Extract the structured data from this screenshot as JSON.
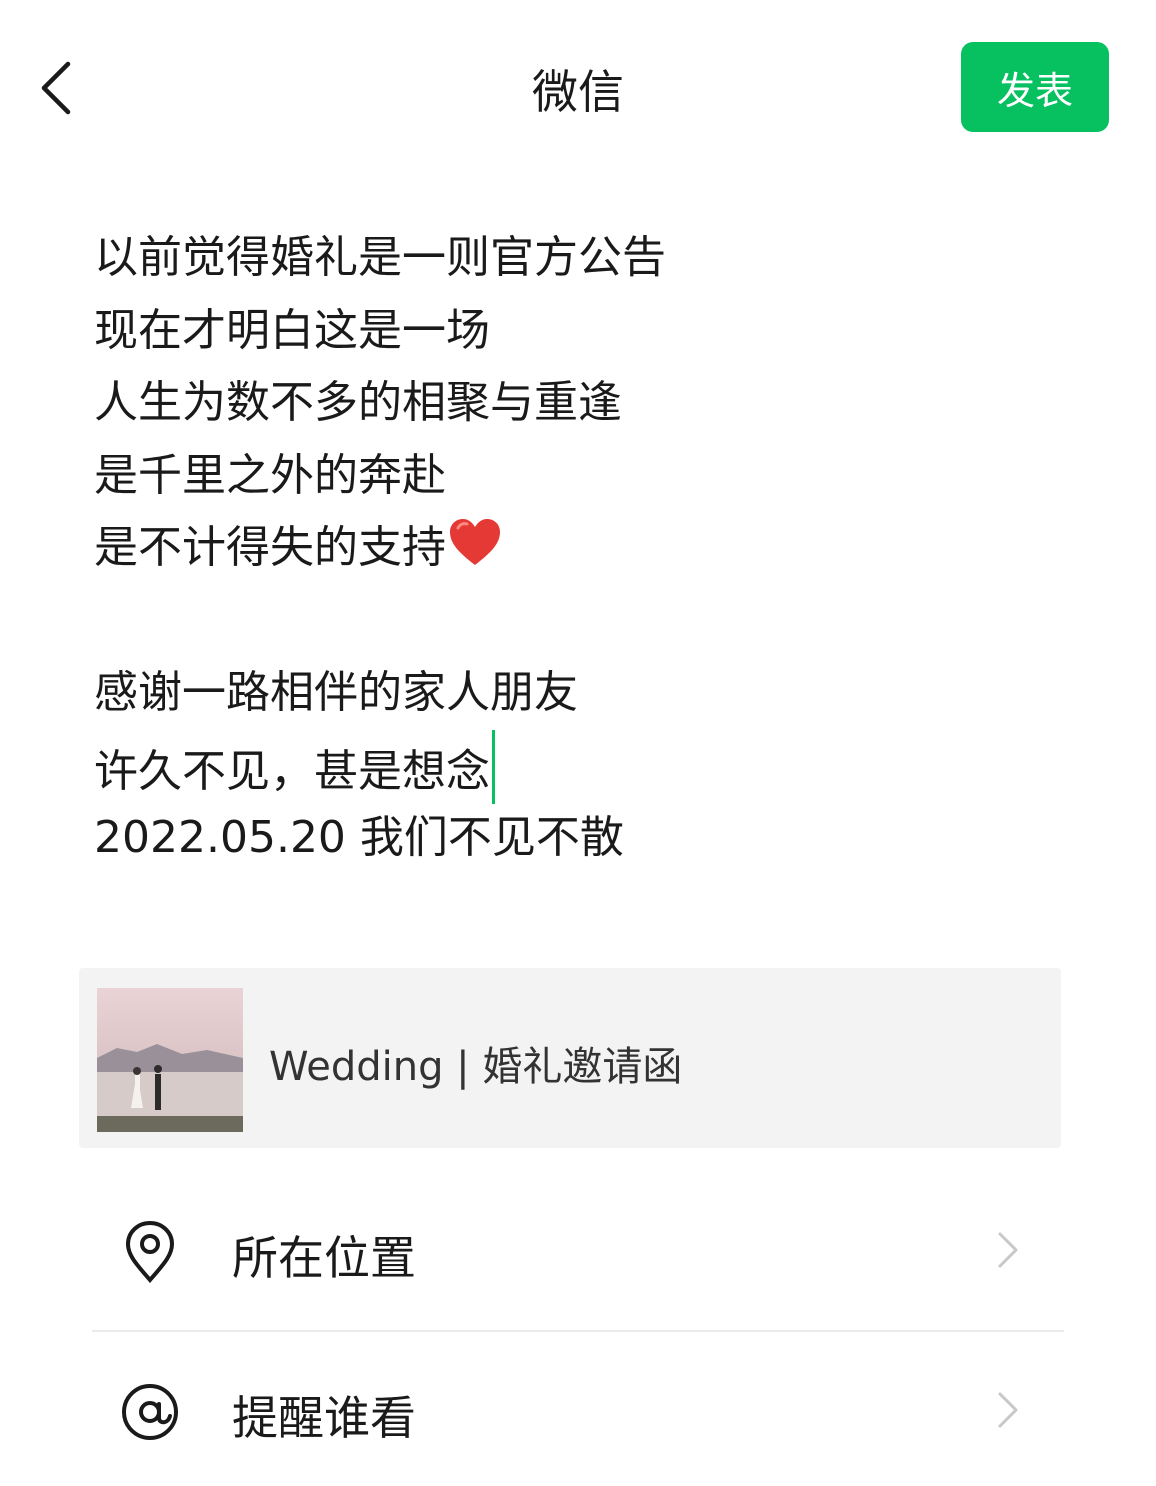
{
  "nav": {
    "title": "微信",
    "publish_label": "发表"
  },
  "post": {
    "lines": [
      "以前觉得婚礼是一则官方公告",
      "现在才明白这是一场",
      "人生为数不多的相聚与重逢",
      "是千里之外的奔赴",
      "是不计得失的支持",
      "",
      "感谢一路相伴的家人朋友",
      "许久不见，甚是想念",
      "2022.05.20 我们不见不散"
    ]
  },
  "link_card": {
    "title": "Wedding | 婚礼邀请函"
  },
  "options": {
    "location_label": "所在位置",
    "remind_label": "提醒谁看"
  },
  "colors": {
    "accent": "#07c160",
    "heart": "#e53935"
  }
}
